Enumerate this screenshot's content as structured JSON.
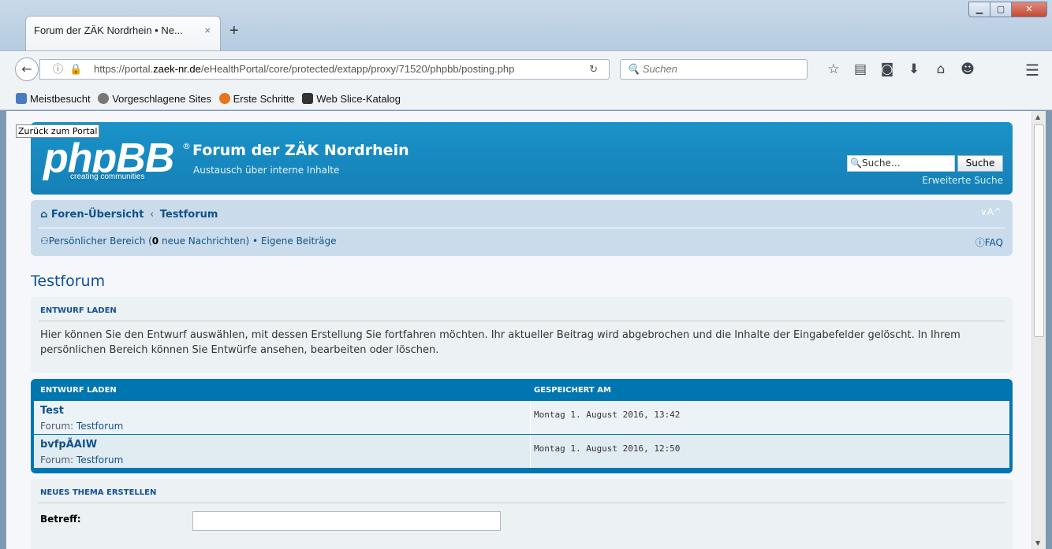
{
  "browser": {
    "tab_title": "Forum der ZÄK Nordrhein • Ne...",
    "tab_close": "×",
    "new_tab": "+",
    "url_prefix": "https://portal.",
    "url_domain": "zaek-nr.de",
    "url_path": "/eHealthPortal/core/protected/extapp/proxy/71520/phpbb/posting.php",
    "search_placeholder": "Suchen",
    "bookmarks": [
      "Meistbesucht",
      "Vorgeschlagene Sites",
      "Erste Schritte",
      "Web Slice-Katalog"
    ]
  },
  "portal_link": "Zurück zum Portal",
  "header": {
    "logo": "phpBB",
    "logo_sub": "creating communities",
    "title": "Forum der ZÄK Nordrhein",
    "description": "Austausch über interne Inhalte",
    "search_value": "Suche…",
    "search_button": "Suche",
    "advanced_search": "Erweiterte Suche"
  },
  "nav": {
    "crumb_home": "Foren-Übersicht",
    "crumb_sep": "‹",
    "crumb_forum": "Testforum",
    "font_size": "∨A^",
    "personal_area": "Persönlicher Bereich (",
    "new_messages_count": "0",
    "new_messages_suffix": " neue Nachrichten)",
    "bullet": " • ",
    "own_posts": "Eigene Beiträge",
    "faq": "FAQ"
  },
  "page_title": "Testforum",
  "load_draft_panel": {
    "heading": "ENTWURF LADEN",
    "text": "Hier können Sie den Entwurf auswählen, mit dessen Erstellung Sie fortfahren möchten. Ihr aktueller Beitrag wird abgebrochen und die Inhalte der Eingabefelder gelöscht. In Ihrem persönlichen Bereich können Sie Entwürfe ansehen, bearbeiten oder löschen."
  },
  "drafts_table": {
    "col_draft": "ENTWURF LADEN",
    "col_saved": "GESPEICHERT AM",
    "rows": [
      {
        "title": "Test",
        "forum_label": "Forum: ",
        "forum": "Testforum",
        "saved": "Montag 1. August 2016, 13:42"
      },
      {
        "title": "bvfpÃAIW",
        "forum_label": "Forum: ",
        "forum": "Testforum",
        "saved": "Montag 1. August 2016, 12:50"
      }
    ]
  },
  "new_topic": {
    "heading": "NEUES THEMA ERSTELLEN",
    "subject_label": "Betreff:"
  }
}
